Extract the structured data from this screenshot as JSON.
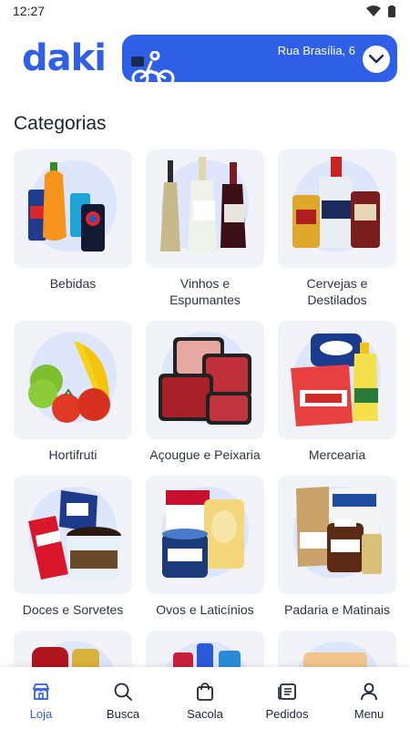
{
  "status": {
    "time": "12:27"
  },
  "header": {
    "logo": "daki",
    "address": "Rua Brasília, 6"
  },
  "section_title": "Categorias",
  "categories": [
    {
      "label": "Bebidas"
    },
    {
      "label": "Vinhos e Espumantes"
    },
    {
      "label": "Cervejas e Destilados"
    },
    {
      "label": "Hortifruti"
    },
    {
      "label": "Açougue e Peixaria"
    },
    {
      "label": "Mercearia"
    },
    {
      "label": "Doces e Sorvetes"
    },
    {
      "label": "Ovos e Laticínios"
    },
    {
      "label": "Padaria e Matinais"
    }
  ],
  "nav": [
    {
      "label": "Loja",
      "icon": "store-icon",
      "active": true
    },
    {
      "label": "Busca",
      "icon": "search-icon"
    },
    {
      "label": "Sacola",
      "icon": "bag-icon"
    },
    {
      "label": "Pedidos",
      "icon": "receipt-icon"
    },
    {
      "label": "Menu",
      "icon": "user-icon"
    }
  ],
  "colors": {
    "brand": "#2f5fe6",
    "card_bg": "#f1f3f8"
  }
}
